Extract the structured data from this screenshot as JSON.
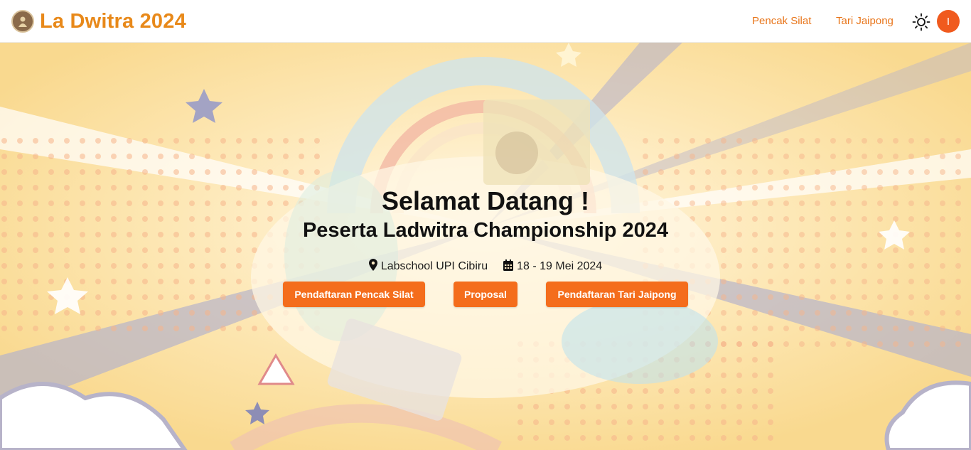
{
  "navbar": {
    "brand_title": "La Dwitra 2024",
    "links": [
      "Pencak Silat",
      "Tari Jaipong"
    ],
    "theme_icon": "sun-icon",
    "avatar_initial": "I",
    "colors": {
      "brand": "#e8891a",
      "link": "#e8751a",
      "avatar": "#f05a1e"
    }
  },
  "hero": {
    "title": "Selamat Datang !",
    "subtitle": "Peserta Ladwitra Championship 2024",
    "location": "Labschool UPI Cibiru",
    "date": "18 - 19 Mei 2024",
    "location_icon": "map-pin-icon",
    "date_icon": "calendar-icon",
    "buttons": [
      "Pendaftaran Pencak Silat",
      "Proposal",
      "Pendaftaran Tari Jaipong"
    ],
    "colors": {
      "button": "#f46d1c",
      "background": "#fbe3a8"
    }
  }
}
